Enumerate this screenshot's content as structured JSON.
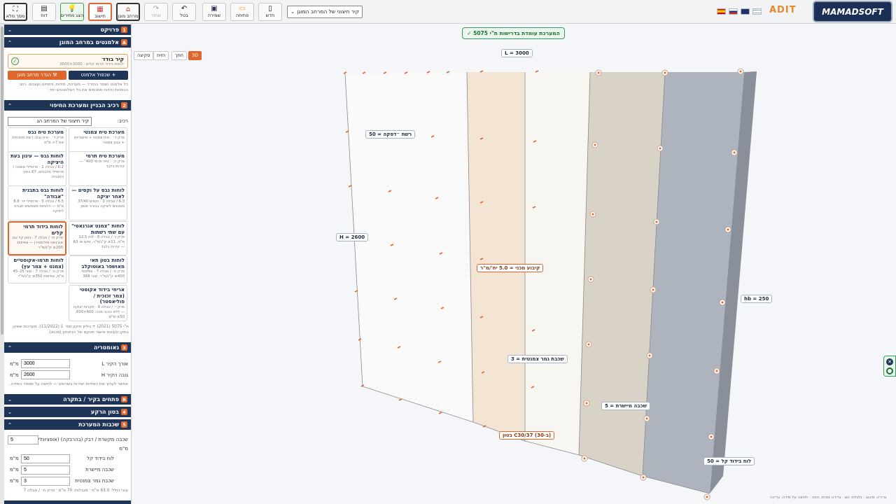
{
  "toolbar": {
    "fullscreen": "מסך מלא",
    "report": "דוח",
    "show_prices": "הצג מחירים",
    "calculate": "חישוב",
    "protected_space": "מרחב מוגן",
    "redo": "שחזר",
    "undo": "בטל",
    "save": "שמירה",
    "open": "פתיחה",
    "new": "חדש",
    "wall_select": "קיר חיצוני של המרחב המוגן",
    "adit": "ADIT",
    "logo": "MAMADSOFT"
  },
  "view": {
    "btn_3d": "3D",
    "btn_section": "חתך",
    "btn_elevation": "חזית",
    "btn_sketch": "סקיצה",
    "status": "✓ המערכת עומדת בדרישות ת\"י 5075"
  },
  "labels": {
    "L": "L = 3000",
    "H": "H = 2600",
    "hb": "hb = 250",
    "mesh": "רשת ״דסקה = 50",
    "fixing": "קיבוע מכני = 5.0 יח'/מ\"ר",
    "cement": "שכבת גמר צמנטית = 3",
    "leveling": "שכבה מיישרת = 5",
    "concrete": "בטון C30/37 (ב-30)",
    "insulation": "לוח בידוד קל = 50",
    "bottom_hint": "גרירה: סיבוב · גלגלת: זום · גרירה ימנית: הזזה · לחיצה על מידה: עריכה"
  },
  "sidebar": {
    "s1": {
      "n": "1",
      "title": "פרויקט"
    },
    "sA": {
      "n": "A",
      "title": "אלמנטים במרחב המוגן"
    },
    "elem_name": "קיר בודד",
    "elem_desc": "לוחות בידוד תרמי קלים · 3000×2600",
    "btn_add": "+ שכפול אלמנט",
    "btn_define": "⚒ הגדר מרחב מוגן",
    "elem_note": "כל אלמנט נשמר בנפרד — מערכת, מידות, פתחים ועוגנים. כתב הכמויות והדוח מסכמים את כל האלמנטים יחד.",
    "s2": {
      "n": "2",
      "title": "רכיב הבניין ומערכת החיפוי"
    },
    "component_label": "רכיב:",
    "component_value": "קיר חיצוני של המרחב הג",
    "cards": [
      {
        "t": "מערכת טיח צמנטי",
        "d": "פרק ד׳ · טיח צמנטי + מישוריות + צבע צמנטי"
      },
      {
        "t": "מערכת טיח גבס",
        "d": "פרק ד׳ · טיח גבס, רשת מתכתית אם 7< מ\"מ"
      },
      {
        "t": "מערכת טיח תרמי",
        "d": "פרק ה׳ · טיח תרמי 400\" — קירות בלבד"
      },
      {
        "t": "לוחות גבס — עיגון בעת היציקה",
        "d": "6.2 / טבלה 2 · פרופילי אומגה / פרופילי מלבניים, 67 בתוך התבנית"
      },
      {
        "t": "לוחות גבס על וקסים — לאחר יציקה",
        "d": "6.3 / טבלה 3 · וקסים 37/40 מעוגנים ליציקה בבורגי פגמן"
      },
      {
        "t": "לוחות גבס בתבנית \"אבודה\"",
        "d": "6.5 / טבלה 5 · פרופילי יח׳ 8.8 מ\"מ — הלוחות משמשים תבנית ליציקה"
      },
      {
        "t": "לוחות \"צמנט אגרגאטי\" עם שתי רשתות",
        "d": "פרק ז׳ / טבלה 6 · לוח 12.5 מ\"מ, 11≥ ק\"ג/מ\"ר, סיום או A3 — קירות בלבד"
      },
      {
        "t": "לוחות בידוד תרמי קלים",
        "d": "פרק ח׳ / טבלה 7 · בטון קל עם אגרגאט פוליסטירן — צפיפות 200≥ ק\"ג/מ\"ר"
      },
      {
        "t": "לוחות בטון תאי מאושפר באוטוקלב",
        "d": "פרק ט׳ / טבלה 7 · צפיפות 400≥ ק\"ג/מ\"ר, עובי 368"
      },
      {
        "t": "לוחות תרמו-אקוסטיים (צמנט + צמר עץ)",
        "d": "פרק ט׳ / טבלה 7 · עובי 25–45 מ\"מ, צפיפות 350≥ ק\"ג/מ\"ר"
      },
      {
        "t": "אריחי בידוד אקוסטי (צמר זכוכית / פוליאסטר)",
        "d": "פרק י׳ / טבלה 8 · תקרות יצוקה — ללא כוכבי מכני, 600×600, 50≥ מ\"מ"
      }
    ],
    "std_note": "ת\"י 5075 (2021) + גיליון תיקון מס׳ 1 (11/2022). מערכות שאינן בתקן טעונות אישור מטעם של הביטחון (מכוא).",
    "s3": {
      "n": "3",
      "title": "גאומטריה"
    },
    "len_label": "אורך הקיר L",
    "len_value": "3000",
    "unit": "מ\"מ",
    "h_label": "גובה הקיר H",
    "h_value": "2600",
    "geo_note": "אפשר לערוך את המידות ישירות בשרטוט — לחיצה על מספר המידה.",
    "sB": {
      "n": "B",
      "title": "פתחים בקיר / בתקרה"
    },
    "s4": {
      "n": "4",
      "title": "בטון הרקע"
    },
    "s5": {
      "n": "5",
      "title": "שכבות המערכת"
    },
    "adh_label": "שכבה מקשרת / דבק (בהרבקה) (אופציונלי)",
    "adh_value": "5",
    "ins_label": "לוח בידוד קל",
    "ins_value": "50",
    "lev_label": "שכבה מיישרת",
    "lev_value": "5",
    "fin_label": "שכבת גמר צמנטית",
    "fin_value": "3",
    "total_note": "עובי כולל: 63.0 מ\"מ · מגבלות: 70 מ\"מ · פרק ח׳ / טבלה 7"
  }
}
